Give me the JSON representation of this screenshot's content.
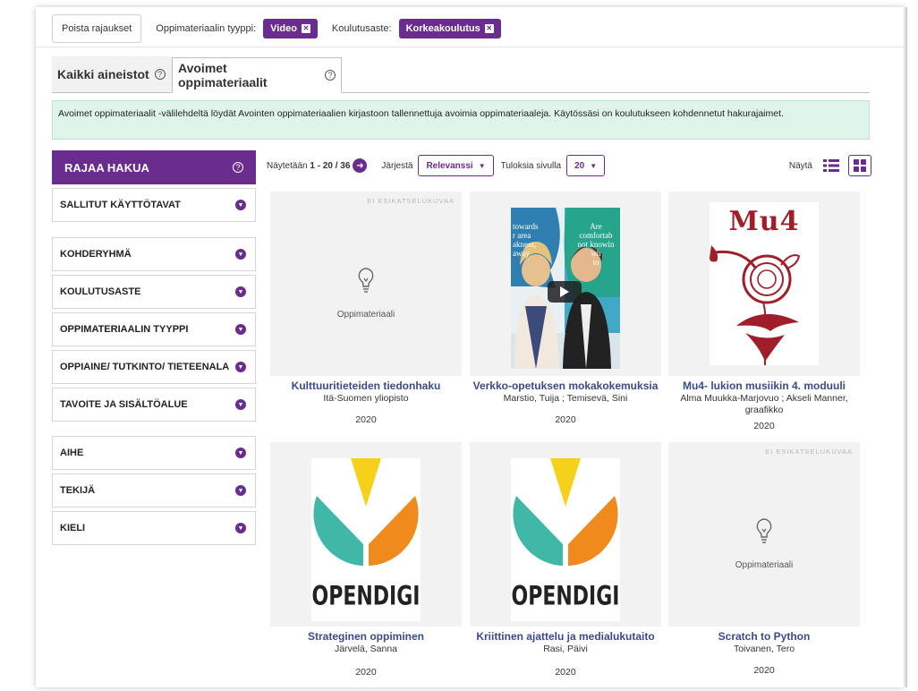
{
  "filters": {
    "clear_label": "Poista rajaukset",
    "type_label": "Oppimateriaalin tyyppi:",
    "type_chip": "Video",
    "level_label": "Koulutusaste:",
    "level_chip": "Korkeakoulutus"
  },
  "tabs": [
    {
      "label": "Kaikki aineistot",
      "active": false
    },
    {
      "label": "Avoimet oppimateriaalit",
      "active": true
    }
  ],
  "info_text": "Avoimet oppimateriaalit -välilehdeltä löydät Avointen oppimateriaalien kirjastoon tallennettuja avoimia oppimateriaaleja. Käytössäsi on koulutukseen kohdennetut hakurajaimet.",
  "sidebar": {
    "title": "RAJAA HAKUA",
    "facets": [
      "SALLITUT KÄYTTÖTAVAT",
      "KOHDERYHMÄ",
      "KOULUTUSASTE",
      "OPPIMATERIAALIN TYYPPI",
      "OPPIAINE/ TUTKINTO/ TIETEENALA",
      "TAVOITE JA SISÄLTÖALUE",
      "AIHE",
      "TEKIJÄ",
      "KIELI"
    ]
  },
  "toolbar": {
    "showing_prefix": "Näytetään",
    "showing_range": "1 - 20",
    "showing_sep": "/",
    "showing_total": "36",
    "sort_label": "Järjestä",
    "sort_value": "Relevanssi",
    "per_page_label": "Tuloksia sivulla",
    "per_page_value": "20",
    "view_label": "Näytä"
  },
  "results": [
    {
      "title": "Kulttuuritieteiden tiedonhaku",
      "author": "Itä-Suomen yliopisto",
      "year": "2020",
      "thumb": "placeholder",
      "no_preview": "EI ESIKATSELUKUVAA",
      "placeholder_label": "Oppimateriaali"
    },
    {
      "title": "Verkko-opetuksen mokakokemuksia",
      "author": "Marstio, Tuija ; Temisevä, Sini",
      "year": "2020",
      "thumb": "video",
      "video_text_left": "towards\nr area\nakness,\naway",
      "video_text_right": "Are\ncomfortab\nnot knowin\nwh\nto"
    },
    {
      "title": "Mu4- lukion musiikin 4. moduuli",
      "author": "Alma Muukka-Marjovuo ; Akseli Manner, graafikko",
      "year": "2020",
      "thumb": "mu4",
      "logo_text": "Mu4"
    },
    {
      "title": "Strateginen oppiminen",
      "author": "Järvelä, Sanna",
      "year": "2020",
      "thumb": "opendigi",
      "logo_text": "OPENDIGI"
    },
    {
      "title": "Kriittinen ajattelu ja medialukutaito",
      "author": "Rasi, Päivi",
      "year": "2020",
      "thumb": "opendigi",
      "logo_text": "OPENDIGI"
    },
    {
      "title": "Scratch to Python",
      "author": "Toivanen, Tero",
      "year": "2020",
      "thumb": "placeholder",
      "no_preview": "EI ESIKATSELUKUVAA",
      "placeholder_label": "Oppimateriaali"
    }
  ],
  "colors": {
    "brand": "#6a2d8f",
    "info_bg": "#dff5e9",
    "title_link": "#3b4a8e",
    "opendigi_teal": "#3fb8a8",
    "opendigi_orange": "#f08a1d",
    "opendigi_yellow": "#f6d11b",
    "mu4_red": "#a01e2a"
  }
}
